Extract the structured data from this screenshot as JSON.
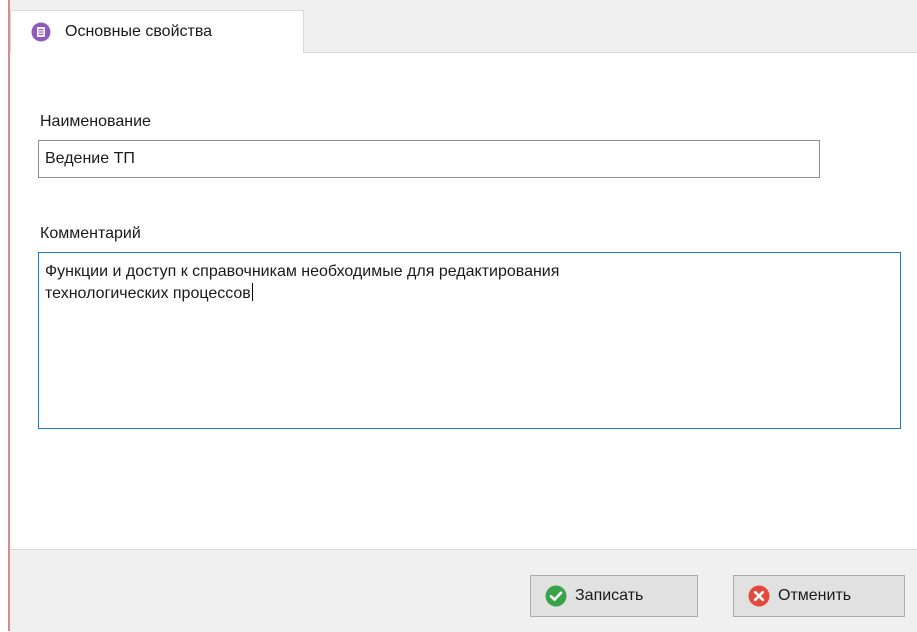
{
  "tab": {
    "label": "Основные свойства",
    "icon": "document-list-icon",
    "icon_color": "#8e5bc6"
  },
  "form": {
    "name_label": "Наименование",
    "name_value": "Ведение ТП",
    "comment_label": "Комментарий",
    "comment_value": "Функции и доступ к справочникам необходимые для редактирования\nтехнологических процессов"
  },
  "footer": {
    "save_label": "Записать",
    "save_icon": "check-circle-icon",
    "save_color": "#3aa34a",
    "cancel_label": "Отменить",
    "cancel_icon": "close-circle-icon",
    "cancel_color": "#e24b3b"
  },
  "colors": {
    "active_border": "#1e7ad6",
    "left_accent": "#d98a8a"
  }
}
